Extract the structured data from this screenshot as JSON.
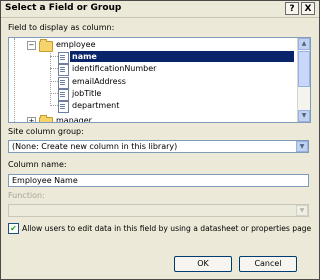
{
  "dialog": {
    "title": "Select a Field or Group",
    "help_button": "?",
    "close_button": "X"
  },
  "fields_section": {
    "label": "Field to display as column:",
    "tree": {
      "groups": [
        {
          "label": "employee",
          "expanded": true,
          "children": [
            {
              "label": "name",
              "selected": true
            },
            {
              "label": "identificationNumber"
            },
            {
              "label": "emailAddress"
            },
            {
              "label": "jobTitle"
            },
            {
              "label": "department"
            }
          ]
        },
        {
          "label": "manager",
          "expanded": false
        }
      ]
    }
  },
  "site_column_group": {
    "label": "Site column group:",
    "value": "(None: Create new column in this library)"
  },
  "column_name": {
    "label": "Column name:",
    "value": "Employee Name"
  },
  "function": {
    "label": "Function:",
    "value": "",
    "disabled": true
  },
  "allow_edit": {
    "checked": true,
    "label": "Allow users to edit data in this field by using a datasheet or properties page"
  },
  "buttons": {
    "ok": "OK",
    "cancel": "Cancel"
  },
  "colors": {
    "dialog_bg": "#ece9d8",
    "selection_bg": "#0a246a",
    "field_border": "#7f9db9"
  }
}
